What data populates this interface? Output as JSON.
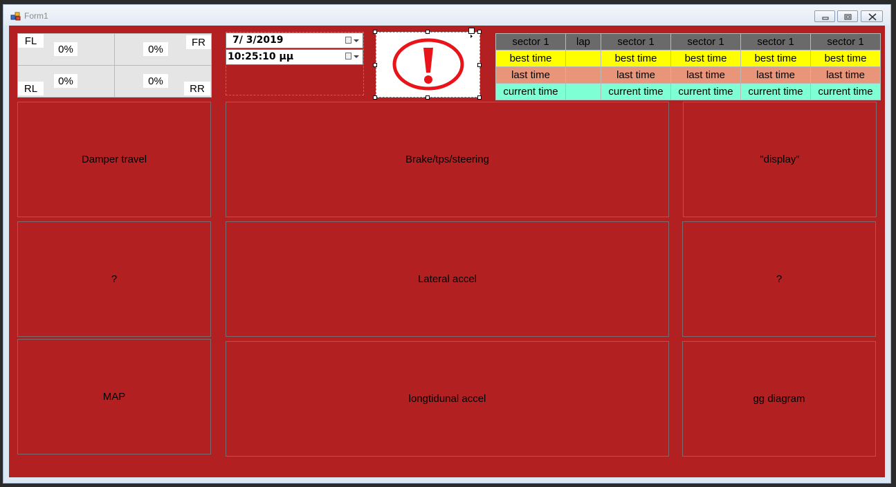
{
  "window": {
    "title": "Form1",
    "buttons": [
      "minimize",
      "restore",
      "close"
    ]
  },
  "tyres": {
    "fl": {
      "label": "FL",
      "value": "0%"
    },
    "fr": {
      "label": "FR",
      "value": "0%"
    },
    "rl": {
      "label": "RL",
      "value": "0%"
    },
    "rr": {
      "label": "RR",
      "value": "0%"
    }
  },
  "datetime": {
    "date": "7/  3/2019",
    "time": "10:25:10 μμ"
  },
  "warning": {
    "icon": "exclamation-icon",
    "color": "#e8141a"
  },
  "timing": {
    "headers": [
      "sector 1",
      "lap",
      "sector 1",
      "sector 1",
      "sector 1",
      "sector 1"
    ],
    "rows": [
      {
        "name": "best",
        "cells": [
          "best time",
          "",
          "best time",
          "best time",
          "best time",
          "best time"
        ]
      },
      {
        "name": "last",
        "cells": [
          "last time",
          "",
          "last time",
          "last time",
          "last time",
          "last time"
        ]
      },
      {
        "name": "current",
        "cells": [
          "current time",
          "",
          "current time",
          "current time",
          "current time",
          "current time"
        ]
      }
    ],
    "colors": {
      "header": "#6a6a6a",
      "best": "#ffff00",
      "last": "#e9957a",
      "current": "#7fffd4"
    }
  },
  "panels": {
    "damper": "Damper travel",
    "brake": "Brake/tps/steering",
    "display": "\"display\"",
    "left_mid": "?",
    "lateral": "Lateral accel",
    "right_mid": "?",
    "map": "MAP",
    "longitudinal": "longtidunal accel",
    "gg": "gg diagram"
  },
  "colors": {
    "client_bg": "#b22022"
  }
}
